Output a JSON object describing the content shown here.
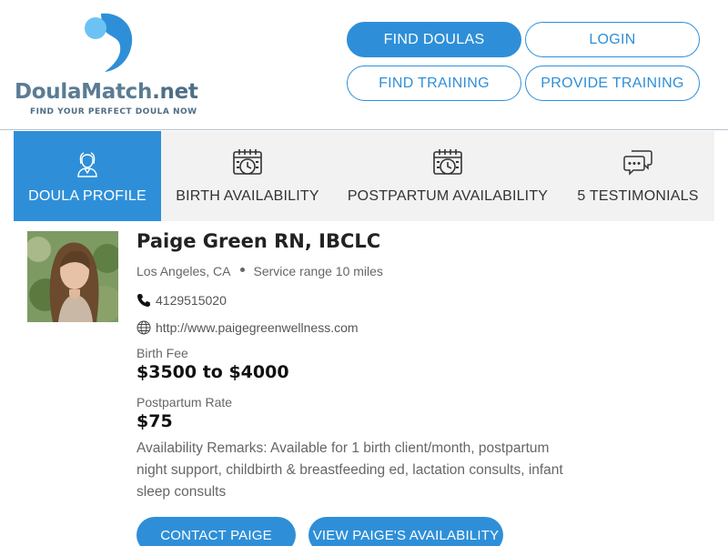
{
  "brand": {
    "logo_doula_match": "DoulaMatch",
    "logo_net": ".net",
    "tagline": "FIND YOUR PERFECT DOULA NOW",
    "primary_color": "#2e8fd8",
    "logo_color": "#5a7c94"
  },
  "nav": {
    "find_doulas": "FIND DOULAS",
    "login": "LOGIN",
    "find_training": "FIND TRAINING",
    "provide_training": "PROVIDE TRAINING"
  },
  "tabs": [
    {
      "label": "DOULA PROFILE",
      "icon": "doula-person-icon",
      "active": true
    },
    {
      "label": "BIRTH AVAILABILITY",
      "icon": "calendar-clock-icon",
      "active": false
    },
    {
      "label": "POSTPARTUM AVAILABILITY",
      "icon": "calendar-clock-icon",
      "active": false
    },
    {
      "label": "5 TESTIMONIALS",
      "icon": "chat-bubbles-icon",
      "active": false
    }
  ],
  "profile": {
    "name": "Paige Green RN, IBCLC",
    "location": "Los Angeles, CA",
    "service_range": "Service range 10 miles",
    "phone": "4129515020",
    "website": "http://www.paigegreenwellness.com",
    "birth_fee_label": "Birth Fee",
    "birth_fee_value": "$3500 to $4000",
    "postpartum_rate_label": "Postpartum Rate",
    "postpartum_rate_value": "$75",
    "remarks": "Availability Remarks: Available for 1 birth client/month, postpartum night support, childbirth & breastfeeding ed, lactation consults, infant sleep consults"
  },
  "actions": {
    "contact": "CONTACT PAIGE",
    "availability": "VIEW PAIGE'S AVAILABILITY"
  }
}
